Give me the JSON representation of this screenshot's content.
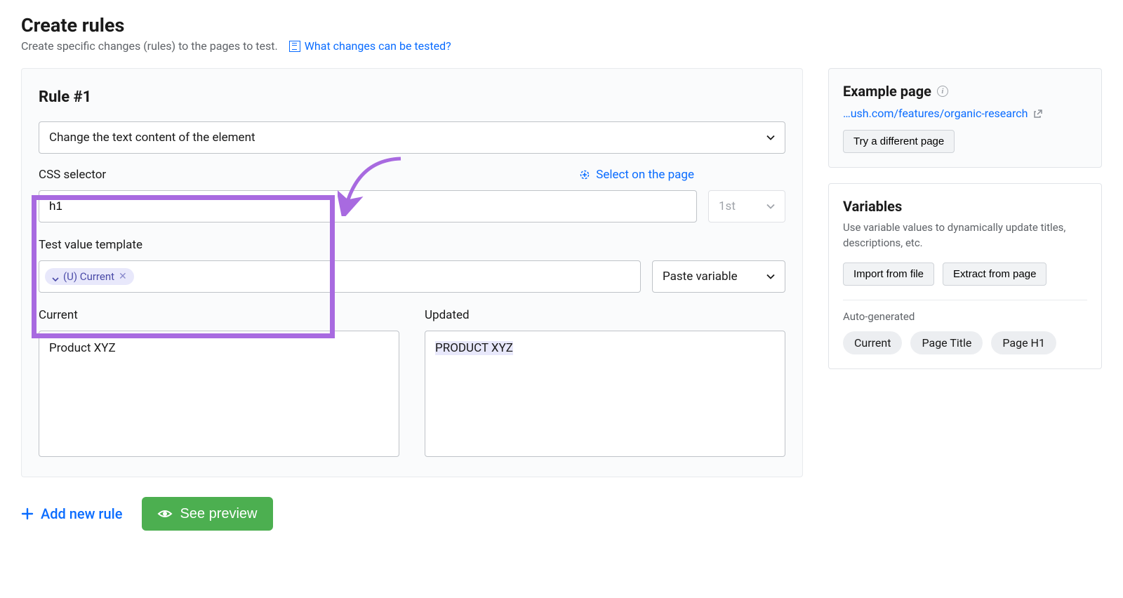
{
  "header": {
    "title": "Create rules",
    "subtitle": "Create specific changes (rules) to the pages to test.",
    "help_link": "What changes can be tested?"
  },
  "rule": {
    "title": "Rule #1",
    "change_type": "Change the text content of the element",
    "css_selector_label": "CSS selector",
    "select_on_page": "Select on the page",
    "css_selector_value": "h1",
    "ordinal": "1st",
    "tvt_label": "Test value template",
    "chip_label": "(U) Current",
    "paste_variable": "Paste variable",
    "current_label": "Current",
    "updated_label": "Updated",
    "current_value": "Product XYZ",
    "updated_value": "PRODUCT XYZ"
  },
  "actions": {
    "add_rule": "Add new rule",
    "see_preview": "See preview"
  },
  "sidebar": {
    "example": {
      "title": "Example page",
      "url": "…ush.com/features/organic-research",
      "try_different": "Try a different page"
    },
    "variables": {
      "title": "Variables",
      "description": "Use variable values to dynamically update titles, descriptions, etc.",
      "import_btn": "Import from file",
      "extract_btn": "Extract from page",
      "autogen_label": "Auto-generated",
      "pills": [
        "Current",
        "Page Title",
        "Page H1"
      ]
    }
  }
}
